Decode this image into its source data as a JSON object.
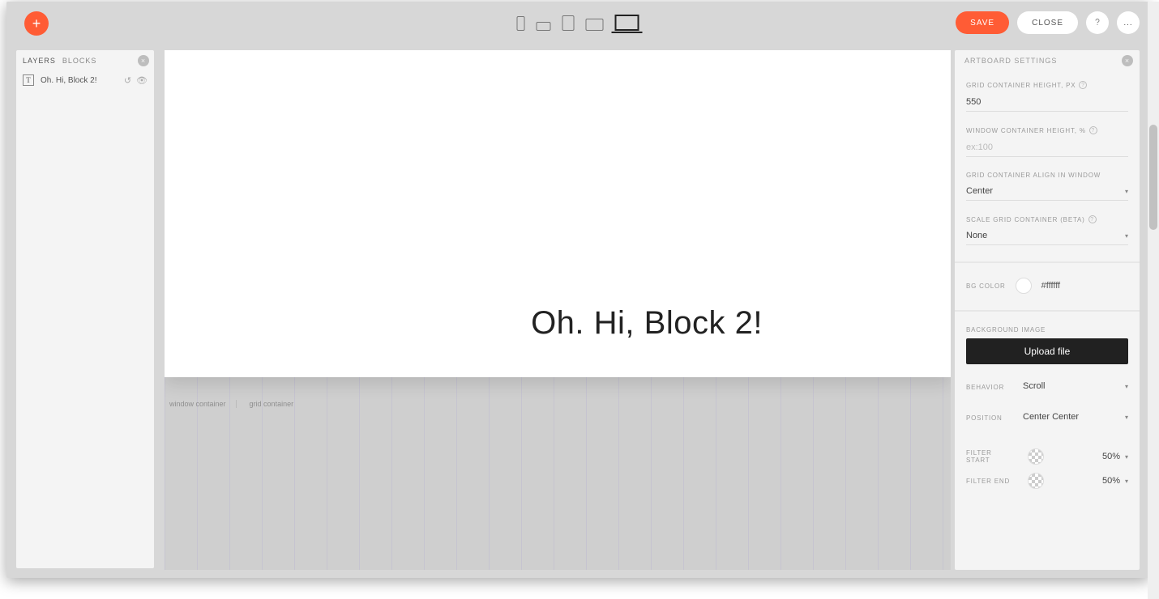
{
  "topbar": {
    "save_label": "SAVE",
    "close_label": "CLOSE",
    "more_label": "..."
  },
  "left_panel": {
    "tabs": {
      "layers": "LAYERS",
      "blocks": "BLOCKS"
    },
    "layer": {
      "label": "Oh. Hi, Block 2!"
    }
  },
  "canvas": {
    "main_text": "Oh. Hi, Block 2!",
    "labels": {
      "window": "window container",
      "grid": "grid container"
    }
  },
  "right_panel": {
    "title": "ARTBOARD SETTINGS",
    "grid_height": {
      "label": "GRID CONTAINER HEIGHT, PX",
      "value": "550"
    },
    "window_height": {
      "label": "WINDOW CONTAINER HEIGHT, %",
      "placeholder": "ex:100"
    },
    "align": {
      "label": "GRID CONTAINER ALIGN IN WINDOW",
      "value": "Center"
    },
    "scale": {
      "label": "SCALE GRID CONTAINER (BETA)",
      "value": "None"
    },
    "bg_color": {
      "label": "BG COLOR",
      "value": "#ffffff"
    },
    "bg_image": {
      "label": "BACKGROUND IMAGE",
      "button": "Upload file"
    },
    "behavior": {
      "label": "BEHAVIOR",
      "value": "Scroll"
    },
    "position": {
      "label": "POSITION",
      "value": "Center Center"
    },
    "filter_start": {
      "label": "FILTER START",
      "value": "50%"
    },
    "filter_end": {
      "label": "FILTER END",
      "value": "50%"
    }
  }
}
